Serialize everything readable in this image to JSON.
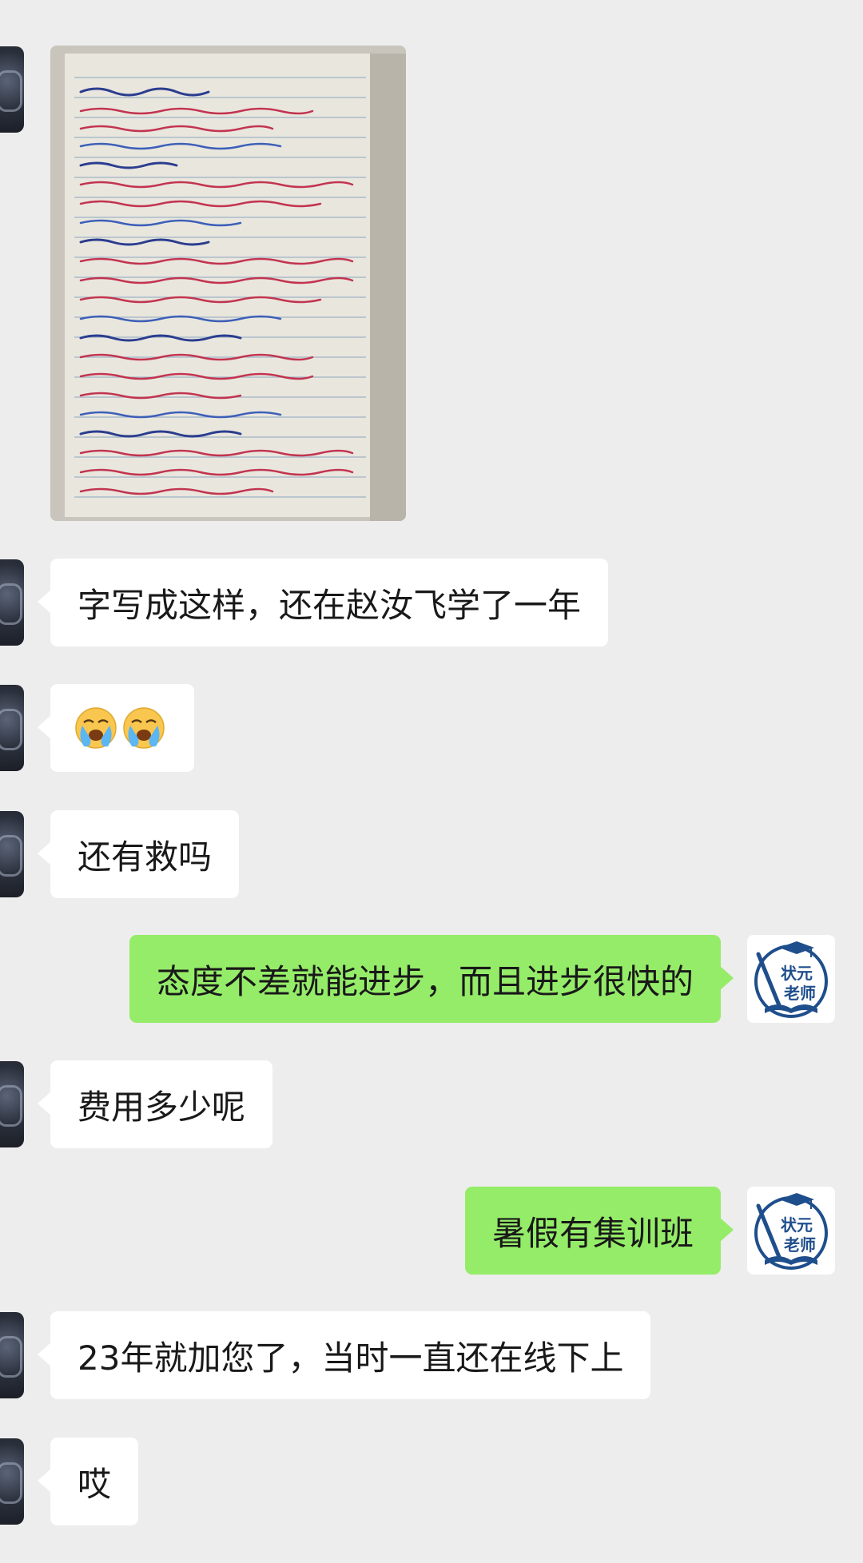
{
  "messages": [
    {
      "id": "m0",
      "side": "left",
      "type": "image"
    },
    {
      "id": "m1",
      "side": "left",
      "text": "字写成这样，还在赵汝飞学了一年"
    },
    {
      "id": "m2",
      "side": "left",
      "type": "emoji",
      "emojis": [
        "loudly-crying-face",
        "loudly-crying-face"
      ]
    },
    {
      "id": "m3",
      "side": "left",
      "text": "还有救吗"
    },
    {
      "id": "m4",
      "side": "right",
      "text": "态度不差就能进步，而且进步很快的"
    },
    {
      "id": "m5",
      "side": "left",
      "text": "费用多少呢"
    },
    {
      "id": "m6",
      "side": "right",
      "text": "暑假有集训班"
    },
    {
      "id": "m7",
      "side": "left",
      "text": "23年就加您了，当时一直还在线下上"
    },
    {
      "id": "m8",
      "side": "left",
      "text": "哎"
    }
  ],
  "teacher_avatar": {
    "line1": "状元",
    "line2": "老师"
  },
  "colors": {
    "background": "#ededed",
    "incoming_bubble": "#ffffff",
    "outgoing_bubble": "#95ec69",
    "avatar_text": "#1f4e8c"
  }
}
